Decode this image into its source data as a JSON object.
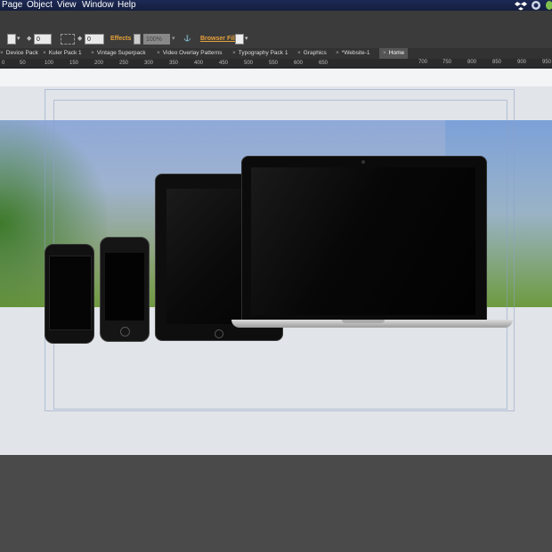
{
  "menubar": {
    "items": [
      "Page",
      "Object",
      "View",
      "Window",
      "Help"
    ]
  },
  "toolbar": {
    "field1_value": "0",
    "field2_value": "0",
    "effects_label": "Effects",
    "opacity_value": "100%",
    "browser_fill_label": "Browser Fill:"
  },
  "tabs": [
    {
      "label": "Device Pack"
    },
    {
      "label": "Kuler Pack 1"
    },
    {
      "label": "Vintage Superpack"
    },
    {
      "label": "Video Overlay Patterns"
    },
    {
      "label": "Typography Pack 1"
    },
    {
      "label": "Graphics"
    },
    {
      "label": "*Website-1"
    },
    {
      "label": "Home",
      "active": true
    }
  ],
  "ruler": {
    "top_ticks": [
      "700",
      "750",
      "800",
      "850",
      "900",
      "950"
    ],
    "bottom_ticks": [
      "0",
      "50",
      "100",
      "150",
      "200",
      "250",
      "300",
      "350",
      "400",
      "450",
      "500",
      "550",
      "600",
      "650"
    ]
  },
  "colors": {
    "menubar": "#1a2450",
    "toolbar": "#3b3b3b",
    "canvas": "#e1e4e8",
    "effects_accent": "#e8a23a"
  },
  "icons": [
    "dropbox-icon",
    "sync-icon",
    "leaf-icon",
    "anchor-icon",
    "fill-swatch-icon"
  ]
}
